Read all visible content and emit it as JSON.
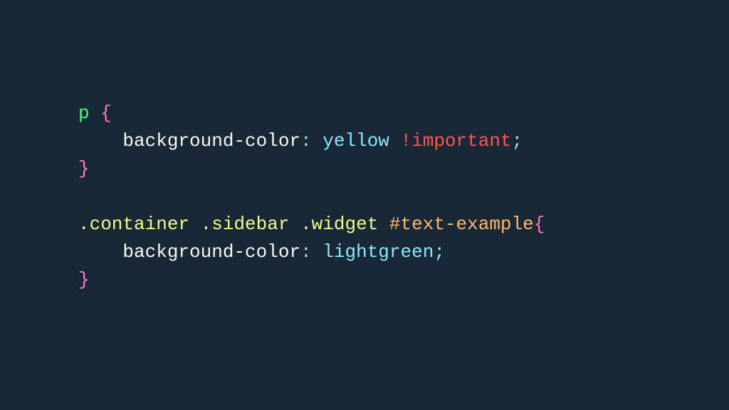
{
  "code": {
    "rule1": {
      "selector": "p",
      "open_brace": " {",
      "indent": "    ",
      "property": "background-color",
      "colon": ":",
      "space": " ",
      "value": "yellow",
      "space2": " ",
      "important": "!important",
      "semicolon": ";",
      "close_brace": "}"
    },
    "blank": "",
    "rule2": {
      "class1": ".container",
      "sp1": " ",
      "class2": ".sidebar",
      "sp2": " ",
      "class3": ".widget",
      "sp3": " ",
      "id": "#text-example",
      "open_brace": "{",
      "indent": "    ",
      "property": "background-color",
      "colon": ":",
      "space": " ",
      "value": "lightgreen",
      "semicolon": ";",
      "close_brace": "}"
    }
  }
}
